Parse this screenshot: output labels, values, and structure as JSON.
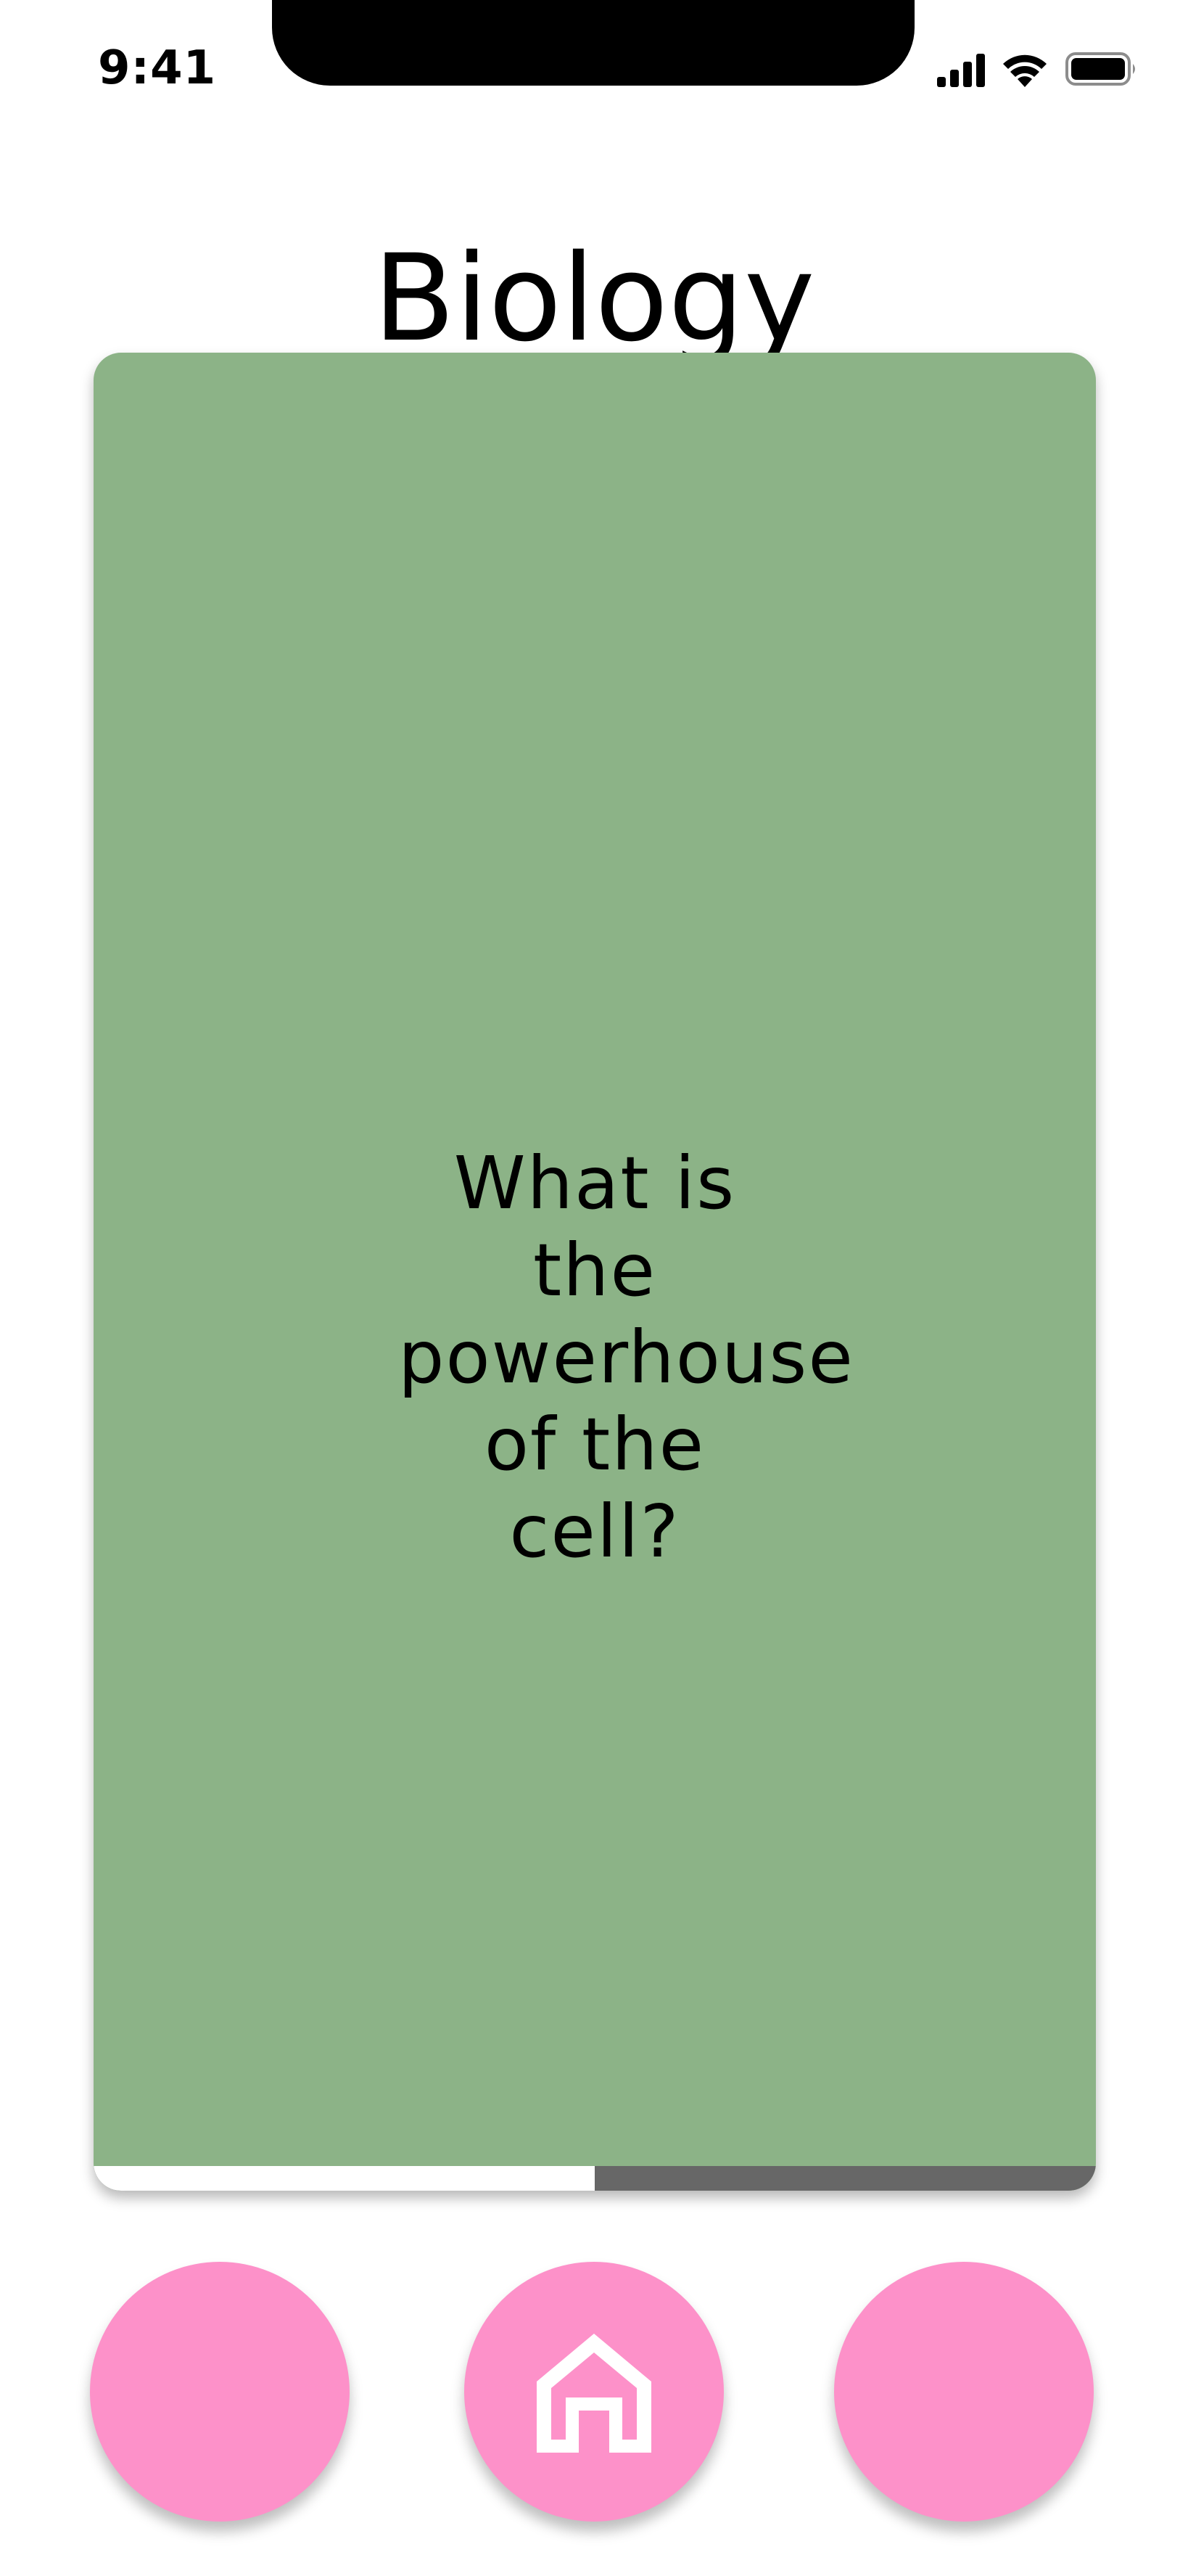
{
  "status_bar": {
    "time": "9:41"
  },
  "header": {
    "title": "Biology"
  },
  "card": {
    "question": "What is the powerhouse of the cell?",
    "background_color": "#8cb387",
    "progress": 0.5
  },
  "controls": {
    "button_color": "#fd91c9",
    "home_icon": "home-icon"
  }
}
